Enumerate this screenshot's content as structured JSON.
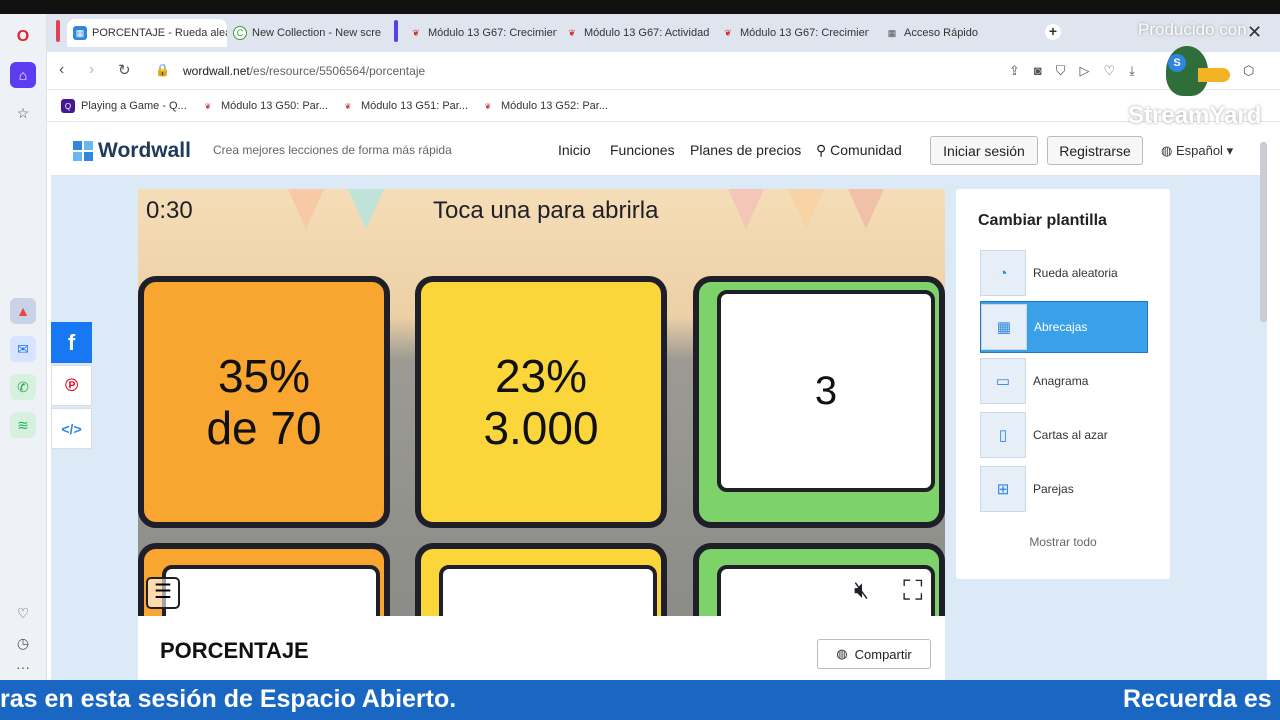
{
  "tabs": [
    {
      "label": "PORCENTAJE - Rueda alea",
      "active": true
    },
    {
      "label": "New Collection - New scre"
    },
    {
      "label": "Módulo 13 G67: Crecimien"
    },
    {
      "label": "Módulo 13 G67: Actividad"
    },
    {
      "label": "Módulo 13 G67: Crecimien"
    },
    {
      "label": "Acceso Rápido"
    }
  ],
  "address": {
    "domain": "wordwall.net",
    "path": "/es/resource/5506564/porcentaje"
  },
  "bookmarks": [
    "Playing a Game - Q...",
    "Módulo 13 G50: Par...",
    "Módulo 13 G51: Par...",
    "Módulo 13 G52: Par..."
  ],
  "wordwall": {
    "logo": "Wordwall",
    "tagline": "Crea mejores lecciones de forma más rápida",
    "nav": [
      "Inicio",
      "Funciones",
      "Planes de precios",
      "Comunidad"
    ],
    "login": "Iniciar sesión",
    "register": "Registrarse",
    "language": "Español"
  },
  "game": {
    "timer": "0:30",
    "instruction": "Toca una para abrirla",
    "cards": [
      {
        "line1": "35%",
        "line2": "de 70",
        "color": "#f9a630"
      },
      {
        "line1": "23%",
        "line2": "3.000",
        "color": "#fbd63a"
      },
      {
        "line1": "3",
        "line2": "",
        "color": "#7dd36a"
      }
    ]
  },
  "activity_title": "PORCENTAJE",
  "share_label": "Compartir",
  "panel": {
    "title": "Cambiar plantilla",
    "templates": [
      "Rueda aleatoria",
      "Abrecajas",
      "Anagrama",
      "Cartas al azar",
      "Parejas"
    ],
    "selected": "Abrecajas",
    "show_all": "Mostrar todo"
  },
  "overlay": {
    "producido": "Producido con",
    "streamyard": "StreamYard"
  },
  "ticker": {
    "left": "ras en esta sesión de Espacio Abierto.",
    "right": "Recuerda es"
  },
  "colors": {
    "wordwall_blue": "#2e86de",
    "ticker": "#1967c2",
    "selected_template": "#3aa0e8"
  }
}
